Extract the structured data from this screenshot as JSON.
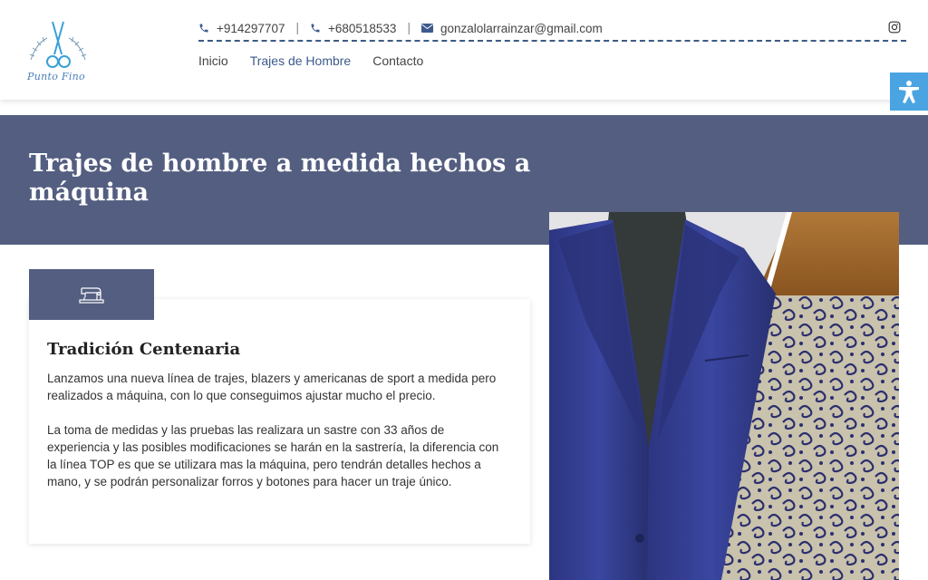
{
  "brand": {
    "logo_text": "Punto Fino"
  },
  "contact": {
    "phone1": "+914297707",
    "separator": "|",
    "phone2": "+680518533",
    "email": "gonzalolarrainzar@gmail.com"
  },
  "nav": {
    "items": [
      {
        "label": "Inicio"
      },
      {
        "label": "Trajes de Hombre"
      },
      {
        "label": "Contacto"
      }
    ],
    "active_index": 1
  },
  "hero": {
    "title": "Trajes de hombre a medida hechos a máquina"
  },
  "card": {
    "title": "Tradición Centenaria",
    "paragraph1": "Lanzamos una nueva línea de trajes, blazers y americanas de sport a medida pero realizados a máquina, con lo que conseguimos ajustar mucho el precio.",
    "paragraph2": "La toma de medidas y las pruebas las realizara un sastre con 33 años de experiencia y las posibles modificaciones se harán en la sastrería, la diferencia con la línea TOP es que se utilizara mas la máquina, pero tendrán detalles hechos a mano, y se podrán personalizar forros y botones para hacer un traje único."
  },
  "icons": {
    "phone": "phone-icon",
    "email": "envelope-icon",
    "social": "instagram-icon",
    "accessibility": "accessibility-icon",
    "card": "sewing-machine-icon"
  },
  "colors": {
    "hero_bg": "#535e80",
    "accent_blue": "#3d5a8c",
    "accessibility_bg": "#4aa4e2"
  }
}
